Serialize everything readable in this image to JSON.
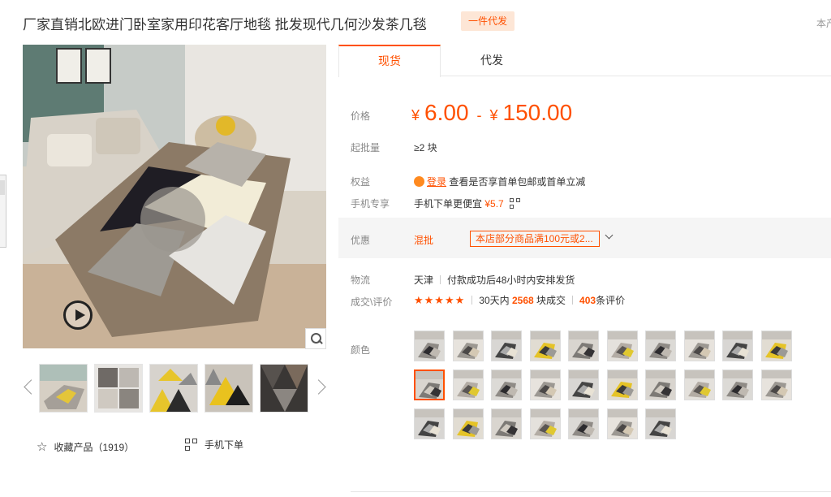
{
  "product": {
    "title": "厂家直销北欧进门卧室家用印花客厅地毯 批发现代几何沙发茶几毯",
    "badge": "一件代发",
    "store_link": "本产"
  },
  "gallery": {
    "favorite_label": "收藏产品（1919）",
    "mobile_order_label": "手机下单"
  },
  "tabs": [
    {
      "label": "现货",
      "active": true
    },
    {
      "label": "代发",
      "active": false
    }
  ],
  "price": {
    "label": "价格",
    "currency": "¥",
    "low": "6.00",
    "separator": "-",
    "high": "150.00"
  },
  "moq": {
    "label": "起批量",
    "value": "≥2 块"
  },
  "benefits": {
    "label": "权益",
    "login_link": "登录",
    "text": "查看是否享首单包邮或首单立减"
  },
  "mobile_deal": {
    "label": "手机专享",
    "text": "手机下单更便宜",
    "price": "¥5.7"
  },
  "promotion": {
    "label": "优惠",
    "type": "混批",
    "text": "本店部分商品满100元或2..."
  },
  "logistics": {
    "label": "物流",
    "origin": "天津",
    "shipping": "付款成功后48小时内安排发货"
  },
  "reviews": {
    "label": "成交\\评价",
    "stars": "★★★★★",
    "period": "30天内",
    "sold_count": "2568",
    "sold_unit": "块成交",
    "review_count": "403",
    "review_unit": "条评价"
  },
  "colors": {
    "label": "颜色",
    "selected_index": 10,
    "count": 27
  },
  "theme": {
    "accent": "#ff5000",
    "badge_bg": "#fde6d6"
  }
}
